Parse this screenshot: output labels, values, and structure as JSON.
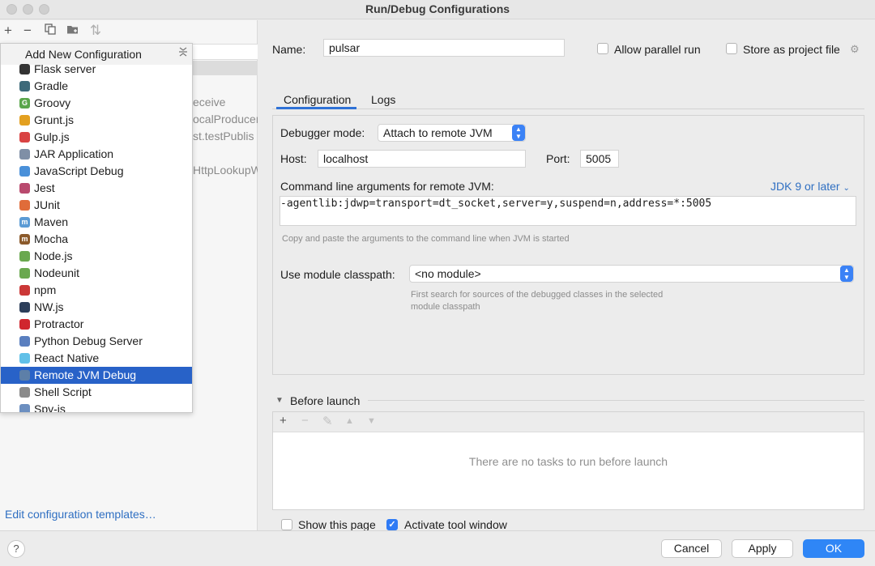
{
  "window": {
    "title": "Run/Debug Configurations"
  },
  "left": {
    "toolbar": [
      "+",
      "−",
      "copy",
      "folder",
      "sort"
    ],
    "tree_fragments": [
      "eceive",
      "ocalProducer",
      "st.testPublis",
      "HttpLookupW"
    ],
    "edit_templates": "Edit configuration templates…"
  },
  "popup": {
    "title": "Add New Configuration",
    "items": [
      {
        "label": "Flask server",
        "icon": "flask-icon",
        "color": "#333333",
        "glyph": ""
      },
      {
        "label": "Gradle",
        "icon": "gradle-icon",
        "color": "#3d6a7a",
        "glyph": ""
      },
      {
        "label": "Groovy",
        "icon": "groovy-icon",
        "color": "#5aa64b",
        "glyph": "G"
      },
      {
        "label": "Grunt.js",
        "icon": "grunt-icon",
        "color": "#e3a020",
        "glyph": ""
      },
      {
        "label": "Gulp.js",
        "icon": "gulp-icon",
        "color": "#d94343",
        "glyph": ""
      },
      {
        "label": "JAR Application",
        "icon": "jar-icon",
        "color": "#7f8fa6",
        "glyph": ""
      },
      {
        "label": "JavaScript Debug",
        "icon": "js-debug-icon",
        "color": "#4a90d9",
        "glyph": ""
      },
      {
        "label": "Jest",
        "icon": "jest-icon",
        "color": "#b94a6e",
        "glyph": ""
      },
      {
        "label": "JUnit",
        "icon": "junit-icon",
        "color": "#e06c3a",
        "glyph": ""
      },
      {
        "label": "Maven",
        "icon": "maven-icon",
        "color": "#5b9bd5",
        "glyph": "m"
      },
      {
        "label": "Mocha",
        "icon": "mocha-icon",
        "color": "#8b5a2b",
        "glyph": "m"
      },
      {
        "label": "Node.js",
        "icon": "nodejs-icon",
        "color": "#6aa84f",
        "glyph": ""
      },
      {
        "label": "Nodeunit",
        "icon": "nodeunit-icon",
        "color": "#6aa84f",
        "glyph": ""
      },
      {
        "label": "npm",
        "icon": "npm-icon",
        "color": "#cb3837",
        "glyph": ""
      },
      {
        "label": "NW.js",
        "icon": "nwjs-icon",
        "color": "#2c3e5a",
        "glyph": ""
      },
      {
        "label": "Protractor",
        "icon": "protractor-icon",
        "color": "#d0262e",
        "glyph": ""
      },
      {
        "label": "Python Debug Server",
        "icon": "python-debug-icon",
        "color": "#5a7fbf",
        "glyph": ""
      },
      {
        "label": "React Native",
        "icon": "react-icon",
        "color": "#61c0e8",
        "glyph": ""
      },
      {
        "label": "Remote JVM Debug",
        "icon": "remote-jvm-icon",
        "color": "#5d7fa8",
        "glyph": "",
        "selected": true
      },
      {
        "label": "Shell Script",
        "icon": "shell-icon",
        "color": "#8a8a8a",
        "glyph": ""
      },
      {
        "label": "Spy-js",
        "icon": "spyjs-icon",
        "color": "#6c8fc0",
        "glyph": ""
      }
    ]
  },
  "config": {
    "name_label": "Name:",
    "name_value": "pulsar",
    "allow_parallel": "Allow parallel run",
    "store_project": "Store as project file",
    "tabs": [
      "Configuration",
      "Logs"
    ],
    "debugger_mode_label": "Debugger mode:",
    "debugger_mode_value": "Attach to remote JVM",
    "host_label": "Host:",
    "host_value": "localhost",
    "port_label": "Port:",
    "port_value": "5005",
    "args_label": "Command line arguments for remote JVM:",
    "jdk_link": "JDK 9 or later",
    "args_value": "-agentlib:jdwp=transport=dt_socket,server=y,suspend=n,address=*:5005",
    "args_hint": "Copy and paste the arguments to the command line when JVM is started",
    "module_label": "Use module classpath:",
    "module_value": "<no module>",
    "module_hint_1": "First search for sources of the debugged classes in the selected",
    "module_hint_2": "module classpath"
  },
  "before_launch": {
    "title": "Before launch",
    "empty_text": "There are no tasks to run before launch"
  },
  "options": {
    "show_page": "Show this page",
    "activate_tool": "Activate tool window"
  },
  "buttons": {
    "help": "?",
    "cancel": "Cancel",
    "apply": "Apply",
    "ok": "OK"
  },
  "colors": {
    "accent": "#2f86f6",
    "selection": "#2862c8",
    "link": "#2f6fc2"
  }
}
